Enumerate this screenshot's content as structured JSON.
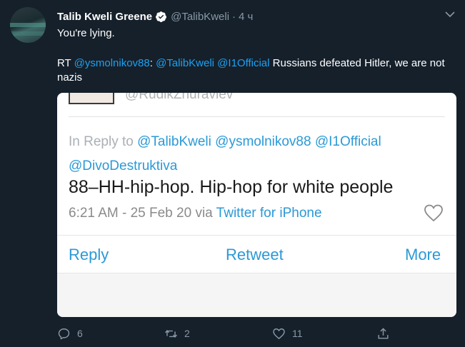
{
  "tweet": {
    "display_name": "Talib Kweli Greene",
    "handle": "@TalibKweli",
    "separator": "·",
    "time": "4 ч",
    "text": "You're lying.",
    "rt_prefix": "RT ",
    "rt_mention1": "@ysmolnikov88",
    "rt_colon": ": ",
    "rt_mention2": "@TalibKweli",
    "rt_mention3": "@I1Official",
    "rt_rest": " Russians defeated Hitler, we are not nazis"
  },
  "card": {
    "clipped_handle": "@RudikZhuravlev",
    "in_reply_to": "In Reply to",
    "reply_mention1": "@TalibKweli",
    "reply_mention2": "@ysmolnikov88",
    "reply_mention3": "@I1Official",
    "reply_mention4": "@DivoDestruktiva",
    "quote_text": "88–HH-hip-hop. Hip-hop for white people",
    "meta_time": "6:21 AM - 25 Feb 20 via ",
    "meta_client": "Twitter for iPhone",
    "action_reply": "Reply",
    "action_retweet": "Retweet",
    "action_more": "More"
  },
  "actions": {
    "reply_count": "6",
    "retweet_count": "2",
    "like_count": "11"
  },
  "icons": {
    "verified": "verified-badge-icon",
    "caret": "chevron-down-icon",
    "reply": "reply-icon",
    "retweet": "retweet-icon",
    "like": "heart-icon",
    "share": "share-icon"
  },
  "colors": {
    "background": "#15202b",
    "link": "#1da1f2",
    "muted": "#8899a6",
    "card_link": "#2b99d6"
  }
}
